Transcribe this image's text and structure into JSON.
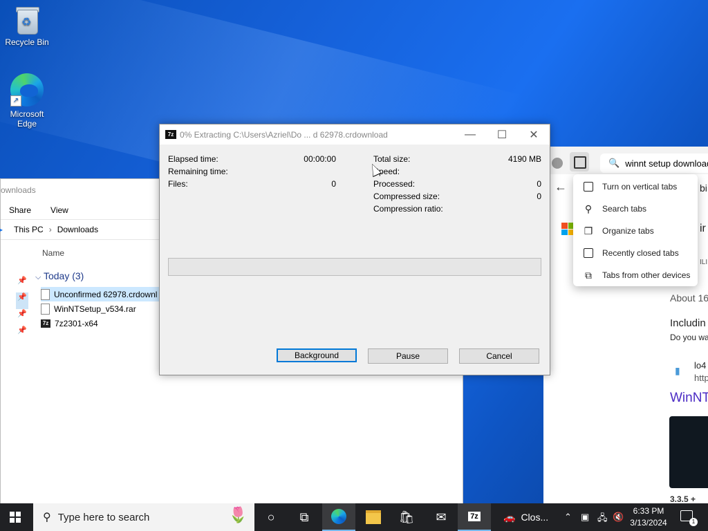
{
  "desktop": {
    "icons": [
      {
        "label": "Recycle Bin"
      },
      {
        "label": "Microsoft Edge"
      }
    ]
  },
  "explorer": {
    "title": "ownloads",
    "ribbon": [
      "Share",
      "View"
    ],
    "breadcrumb": [
      "This PC",
      "Downloads"
    ],
    "column_name": "Name",
    "group_label": "Today (3)",
    "files": [
      {
        "name": "Unconfirmed 62978.crdownl"
      },
      {
        "name": "WinNTSetup_v534.rar"
      },
      {
        "name": "7z2301-x64"
      }
    ]
  },
  "browser": {
    "address": "winnt setup download",
    "page_fragments": {
      "f1": "bi",
      "f2": "ir",
      "f3": "ILI",
      "about": "About 16",
      "including": "Includin",
      "doyou": "Do you wa",
      "lo4": "lo4",
      "http": "http",
      "winnt": "WinNT",
      "bottom": "3.3.5 +"
    }
  },
  "tab_menu": {
    "items": [
      {
        "label": "Turn on vertical tabs",
        "icon": "vertical-tabs-icon"
      },
      {
        "label": "Search tabs",
        "icon": "search-icon"
      },
      {
        "label": "Organize tabs",
        "icon": "organize-tabs-icon"
      },
      {
        "label": "Recently closed tabs",
        "icon": "recently-closed-icon"
      },
      {
        "label": "Tabs from other devices",
        "icon": "devices-icon"
      }
    ]
  },
  "dialog": {
    "app_icon": "7z",
    "title": "0% Extracting C:\\Users\\Azriel\\Do ... d 62978.crdownload",
    "left": [
      {
        "label": "Elapsed time:",
        "value": "00:00:00"
      },
      {
        "label": "Remaining time:",
        "value": ""
      },
      {
        "label": "Files:",
        "value": "0"
      }
    ],
    "right": [
      {
        "label": "Total size:",
        "value": "4190 MB"
      },
      {
        "label": "Speed:",
        "value": ""
      },
      {
        "label": "Processed:",
        "value": "0"
      },
      {
        "label": "Compressed size:",
        "value": "0"
      },
      {
        "label": "Compression ratio:",
        "value": ""
      }
    ],
    "progress": 0,
    "buttons": {
      "background": "Background",
      "pause": "Pause",
      "cancel": "Cancel"
    }
  },
  "taskbar": {
    "search_placeholder": "Type here to search",
    "app_label": "Clos...",
    "time": "6:33 PM",
    "date": "3/13/2024",
    "notification_count": "1",
    "accent": "#76b9ed"
  }
}
